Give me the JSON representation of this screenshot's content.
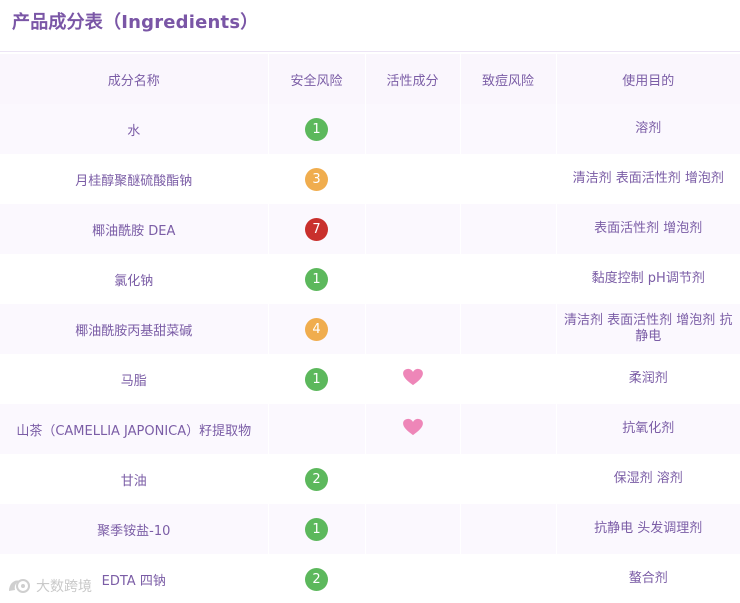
{
  "title": "产品成分表（Ingredients）",
  "columns": {
    "name": "成分名称",
    "safety": "安全风险",
    "active": "活性成分",
    "acne": "致痘风险",
    "purpose": "使用目的"
  },
  "colors": {
    "accent": "#7a56a6",
    "risk_low": "#5cb85c",
    "risk_medium": "#f0ad4e",
    "risk_high": "#c9302c",
    "heart": "#ee86b8"
  },
  "icons": {
    "active_marker": "heart-icon",
    "watermark": "watermark-logo-icon"
  },
  "rows": [
    {
      "name": "水",
      "safety": "1",
      "level": "low",
      "active": false,
      "acne": "",
      "purpose": "溶剂"
    },
    {
      "name": "月桂醇聚醚硫酸酯钠",
      "safety": "3",
      "level": "medium",
      "active": false,
      "acne": "",
      "purpose": "清洁剂 表面活性剂 增泡剂"
    },
    {
      "name": "椰油酰胺 DEA",
      "safety": "7",
      "level": "high",
      "active": false,
      "acne": "",
      "purpose": "表面活性剂 增泡剂"
    },
    {
      "name": "氯化钠",
      "safety": "1",
      "level": "low",
      "active": false,
      "acne": "",
      "purpose": "黏度控制 pH调节剂"
    },
    {
      "name": "椰油酰胺丙基甜菜碱",
      "safety": "4",
      "level": "medium",
      "active": false,
      "acne": "",
      "purpose": "清洁剂 表面活性剂 增泡剂 抗静电"
    },
    {
      "name": "马脂",
      "safety": "1",
      "level": "low",
      "active": true,
      "acne": "",
      "purpose": "柔润剂"
    },
    {
      "name": "山茶（CAMELLIA JAPONICA）籽提取物",
      "safety": "",
      "level": "",
      "active": true,
      "acne": "",
      "purpose": "抗氧化剂"
    },
    {
      "name": "甘油",
      "safety": "2",
      "level": "low",
      "active": false,
      "acne": "",
      "purpose": "保湿剂 溶剂"
    },
    {
      "name": "聚季铵盐-10",
      "safety": "1",
      "level": "low",
      "active": false,
      "acne": "",
      "purpose": "抗静电 头发调理剂"
    },
    {
      "name": "EDTA 四钠",
      "safety": "2",
      "level": "low",
      "active": false,
      "acne": "",
      "purpose": "螯合剂"
    }
  ],
  "watermark": "大数跨境"
}
